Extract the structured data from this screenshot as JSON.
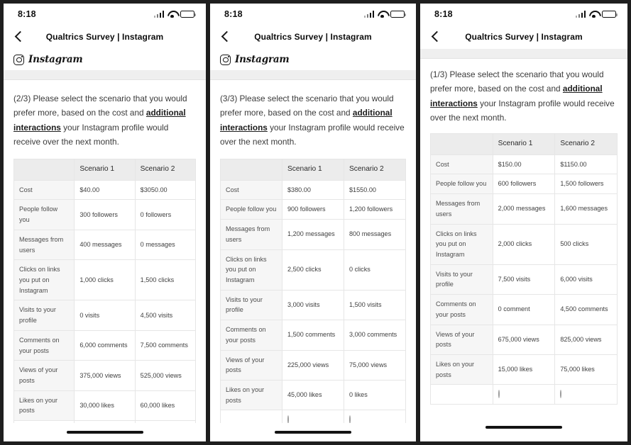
{
  "status_bar": {
    "time": "8:18",
    "icons": [
      "signal-bars-icon",
      "wifi-icon",
      "battery-icon"
    ]
  },
  "nav": {
    "back_icon": "back-chevron-icon",
    "title": "Qualtrics Survey | Instagram"
  },
  "brand": {
    "icon": "instagram-camera-icon",
    "name": "Instagram"
  },
  "table_headers": {
    "blank": "",
    "scenario1": "Scenario 1",
    "scenario2": "Scenario 2"
  },
  "row_labels": [
    "Cost",
    "People follow you",
    "Messages from users",
    "Clicks on links you put on Instagram",
    "Visits to your profile",
    "Comments on your posts",
    "Views of your posts",
    "Likes on your posts"
  ],
  "panels": [
    {
      "id": "panel-2of3",
      "has_brand_row": true,
      "question_prefix": "(2/3) Please select the scenario that you would prefer more, based on the cost and ",
      "question_bold": "additional interactions",
      "question_suffix": " your Instagram profile would receive over the next month.",
      "scenario1": [
        "$40.00",
        "300 followers",
        "400 messages",
        "1,000 clicks",
        "0 visits",
        "6,000 comments",
        "375,000 views",
        "30,000 likes"
      ],
      "scenario2": [
        "$3050.00",
        "0 followers",
        "0 messages",
        "1,500 clicks",
        "4,500 visits",
        "7,500 comments",
        "525,000 views",
        "60,000 likes"
      ]
    },
    {
      "id": "panel-3of3",
      "has_brand_row": true,
      "question_prefix": "(3/3) Please select the scenario that you would prefer more, based on the cost and ",
      "question_bold": "additional interactions",
      "question_suffix": " your Instagram profile would receive over the next month.",
      "scenario1": [
        "$380.00",
        "900 followers",
        "1,200 messages",
        "2,500 clicks",
        "3,000 visits",
        "1,500 comments",
        "225,000 views",
        "45,000 likes"
      ],
      "scenario2": [
        "$1550.00",
        "1,200 followers",
        "800 messages",
        "0 clicks",
        "1,500 visits",
        "3,000 comments",
        "75,000 views",
        "0 likes"
      ]
    },
    {
      "id": "panel-1of3",
      "has_brand_row": false,
      "question_prefix": "(1/3) Please select the scenario that you would prefer more, based on the cost and ",
      "question_bold": "additional interactions",
      "question_suffix": " your Instagram profile would receive over the next month.",
      "scenario1": [
        "$150.00",
        "600 followers",
        "2,000 messages",
        "2,000 clicks",
        "7,500 visits",
        "0 comment",
        "675,000 views",
        "15,000 likes"
      ],
      "scenario2": [
        "$1150.00",
        "1,500 followers",
        "1,600 messages",
        "500 clicks",
        "6,000 visits",
        "4,500 comments",
        "825,000 views",
        "75,000 likes"
      ]
    }
  ]
}
